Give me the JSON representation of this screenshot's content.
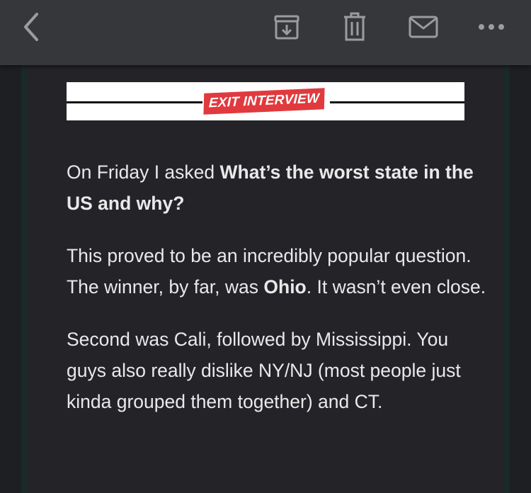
{
  "toolbar": {
    "back_icon": "chevron-left-icon",
    "archive_icon": "archive-icon",
    "delete_icon": "trash-icon",
    "unread_icon": "envelope-icon",
    "more_icon": "more-horizontal-icon",
    "icon_color": "#9b9ca0",
    "background": "#36373a"
  },
  "banner": {
    "label": "EXIT INTERVIEW",
    "tag_color": "#e03a3e"
  },
  "article": {
    "p1_lead": "On Friday I asked ",
    "p1_question": "What’s the worst state in the US and why?",
    "p2_a": "This proved to be an incredibly popular question. The winner, by far, was ",
    "p2_winner": "Ohio",
    "p2_b": ". It wasn’t even close.",
    "p3": "Second was Cali, followed by Mississippi. You guys also really dislike NY/NJ (most people just kinda grouped them together) and CT."
  },
  "colors": {
    "page_background": "#1e1f22",
    "text": "#e9e9ea"
  }
}
